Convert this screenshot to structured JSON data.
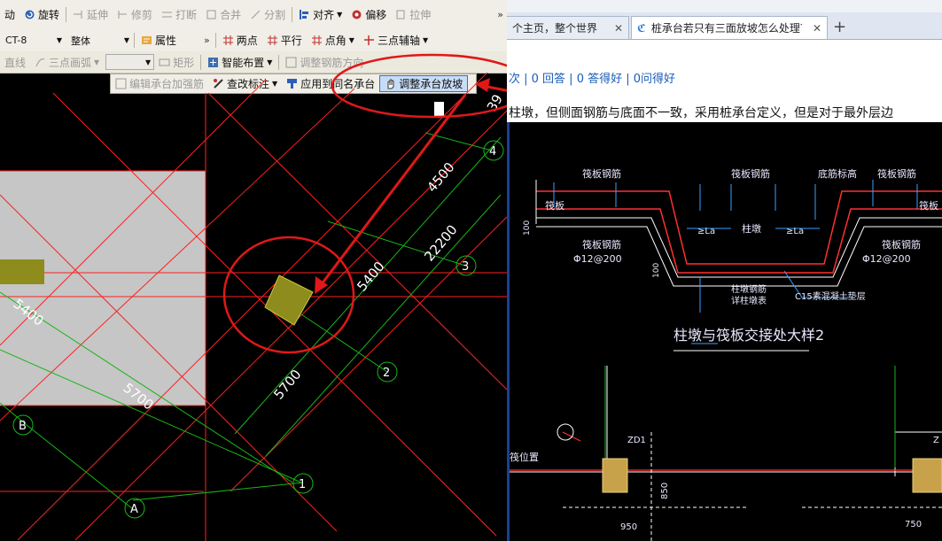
{
  "toolbar1": {
    "move": "动",
    "rotate": "旋转",
    "extend": "延伸",
    "trim": "修剪",
    "break": "打断",
    "merge": "合并",
    "split": "分割",
    "align": "对齐",
    "offset": "偏移",
    "stretch": "拉伸",
    "more": "»"
  },
  "toolbar2": {
    "component_select": "CT-8",
    "scope_select": "整体",
    "properties": "属性",
    "more": "»",
    "two_points": "两点",
    "parallel": "平行",
    "point_angle": "点角",
    "three_point_axis": "三点辅轴"
  },
  "toolbar3": {
    "line": "直线",
    "arc": "三点画弧",
    "rect": "矩形",
    "smart_layout": "智能布置",
    "adjust_rebar": "调整钢筋方向"
  },
  "popup": {
    "edit_reinforce": "编辑承台加强筋",
    "check_label": "查改标注",
    "apply_same": "应用到同名承台",
    "adjust_slope": "调整承台放坡"
  },
  "cad": {
    "dims": [
      "5400",
      "5700",
      "4500",
      "22200",
      "5400",
      "5700",
      "39"
    ],
    "axes": [
      "4",
      "3",
      "2",
      "1",
      "A",
      "B"
    ]
  },
  "browser": {
    "tab1": "个主页，整个世界",
    "tab2": "桩承台若只有三面放坡怎么处理？",
    "new_tab": "+",
    "stats": "次 | 0 回答 | 0 答得好 | 0问得好",
    "description": "柱墩，但侧面钢筋与底面不一致，采用桩承台定义，但是对于最外层边",
    "drawing": {
      "labels_top": [
        "筏板钢筋",
        "筏板钢筋",
        "底筋标高",
        "筏板钢筋"
      ],
      "labels_side": [
        "筏板",
        "筏板"
      ],
      "labels_bottom": [
        "筏板钢筋",
        "筏板钢筋"
      ],
      "column_pier": "柱墩",
      "la": [
        "≥La",
        "≥La"
      ],
      "rebar": [
        "Φ12@200",
        "Φ12@200"
      ],
      "pier_rebar": "柱墩钢筋",
      "pier_rebar2": "详柱墩表",
      "bedding": "C15素混凝土垫层",
      "caption": "柱墩与筏板交接处大样2",
      "dims": [
        "100",
        "100",
        "850",
        "950",
        "750"
      ],
      "zd": [
        "ZD1",
        "Z"
      ],
      "note": "筏位置"
    }
  },
  "colors": {
    "annotation_red": "#e01818",
    "grid_red": "#ff2020",
    "dim_green": "#19b519",
    "selection_blue": "#3a6fc4"
  }
}
